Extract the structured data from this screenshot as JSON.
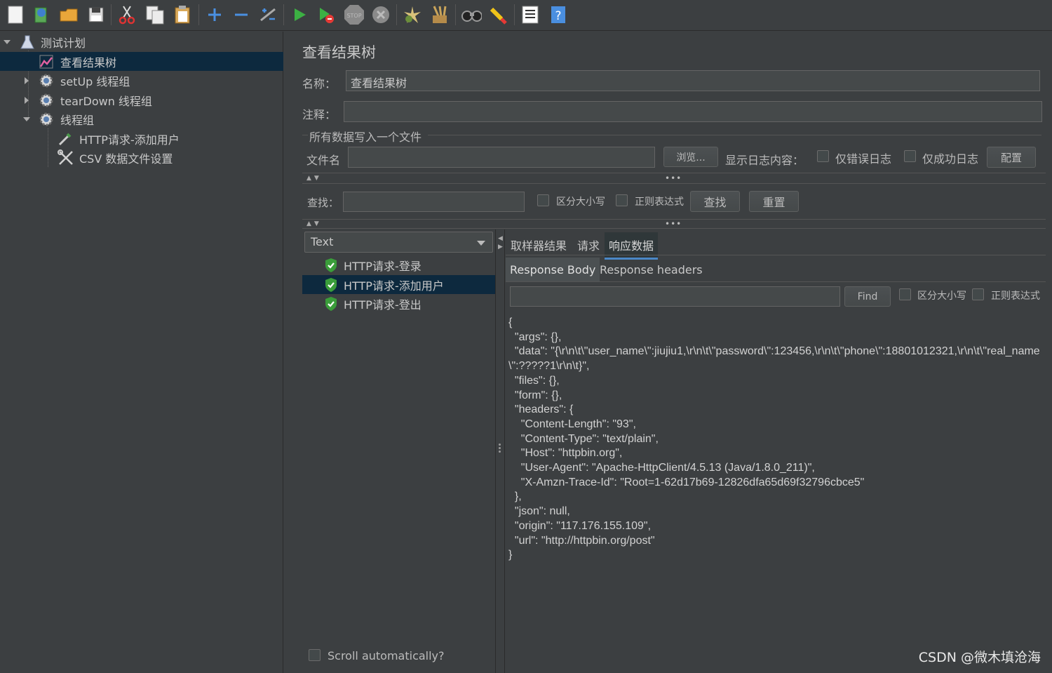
{
  "toolbar": {
    "icons": [
      "new-icon",
      "templates-icon",
      "open-icon",
      "save-icon",
      "cut-icon",
      "copy-icon",
      "paste-icon",
      "expand-icon",
      "collapse-icon",
      "toggle-icon",
      "start-icon",
      "start-no-pause-icon",
      "stop-icon",
      "shutdown-icon",
      "clear-icon",
      "clear-all-icon",
      "search-icon",
      "reset-search-icon",
      "function-helper-icon",
      "help-icon"
    ]
  },
  "tree": {
    "items": [
      {
        "label": "测试计划"
      },
      {
        "label": "查看结果树"
      },
      {
        "label": "setUp 线程组"
      },
      {
        "label": "tearDown 线程组"
      },
      {
        "label": "线程组"
      },
      {
        "label": "HTTP请求-添加用户"
      },
      {
        "label": "CSV 数据文件设置"
      }
    ]
  },
  "panel": {
    "title": "查看结果树",
    "name_label": "名称：",
    "name_value": "查看结果树",
    "comment_label": "注释：",
    "comment_value": "",
    "file_group_title": "所有数据写入一个文件",
    "filename_label": "文件名",
    "filename_value": "",
    "browse_button": "浏览...",
    "log_content_label": "显示日志内容：",
    "errors_only_label": "仅错误日志",
    "success_only_label": "仅成功日志",
    "configure_button": "配置",
    "search_label": "查找：",
    "search_value": "",
    "case_sensitive_label": "区分大小写",
    "regex_label": "正则表达式",
    "find_button": "查找",
    "reset_button": "重置"
  },
  "results": {
    "renderer": "Text",
    "samples": [
      {
        "label": "HTTP请求-登录"
      },
      {
        "label": "HTTP请求-添加用户"
      },
      {
        "label": "HTTP请求-登出"
      }
    ],
    "scroll_auto_label": "Scroll automatically?"
  },
  "detail": {
    "tabs": [
      "取样器结果",
      "请求",
      "响应数据"
    ],
    "subtabs": [
      "Response Body",
      "Response headers"
    ],
    "find_value": "",
    "find_button": "Find",
    "case_sensitive_label": "区分大小写",
    "regex_label": "正则表达式",
    "body": "{\n  \"args\": {},\n  \"data\": \"{\\r\\n\\t\\\"user_name\\\":jiujiu1,\\r\\n\\t\\\"password\\\":123456,\\r\\n\\t\\\"phone\\\":18801012321,\\r\\n\\t\\\"real_name\\\":?????1\\r\\n\\t}\",\n  \"files\": {},\n  \"form\": {},\n  \"headers\": {\n    \"Content-Length\": \"93\",\n    \"Content-Type\": \"text/plain\",\n    \"Host\": \"httpbin.org\",\n    \"User-Agent\": \"Apache-HttpClient/4.5.13 (Java/1.8.0_211)\",\n    \"X-Amzn-Trace-Id\": \"Root=1-62d17b69-12826dfa65d69f32796cbce5\"\n  },\n  \"json\": null,\n  \"origin\": \"117.176.155.109\",\n  \"url\": \"http://httpbin.org/post\"\n}"
  },
  "watermark": "CSDN @微木填沧海",
  "colors": {
    "background": "#3c3f41",
    "selection": "#0d293e",
    "tab_underline": "#4a88c7",
    "success_green": "#3a9d3a"
  }
}
